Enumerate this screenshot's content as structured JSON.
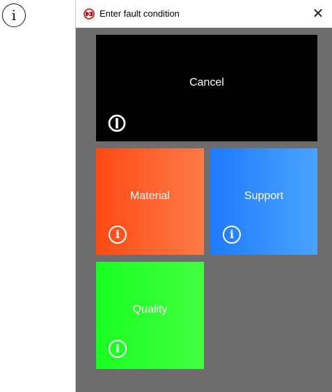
{
  "window": {
    "title": "Enter fault condition",
    "close_symbol": "✕"
  },
  "icons": {
    "outer": "info-icon",
    "app": "app-logo-icon",
    "cancel": "power-icon",
    "tile_info": "info-icon"
  },
  "tiles": {
    "cancel": {
      "label": "Cancel",
      "color": "#000000"
    },
    "material": {
      "label": "Material",
      "color": "#ff5a24"
    },
    "support": {
      "label": "Support",
      "color": "#2d8bff"
    },
    "quality": {
      "label": "Quality",
      "color": "#22ff24"
    }
  },
  "glyphs": {
    "info": "i"
  }
}
